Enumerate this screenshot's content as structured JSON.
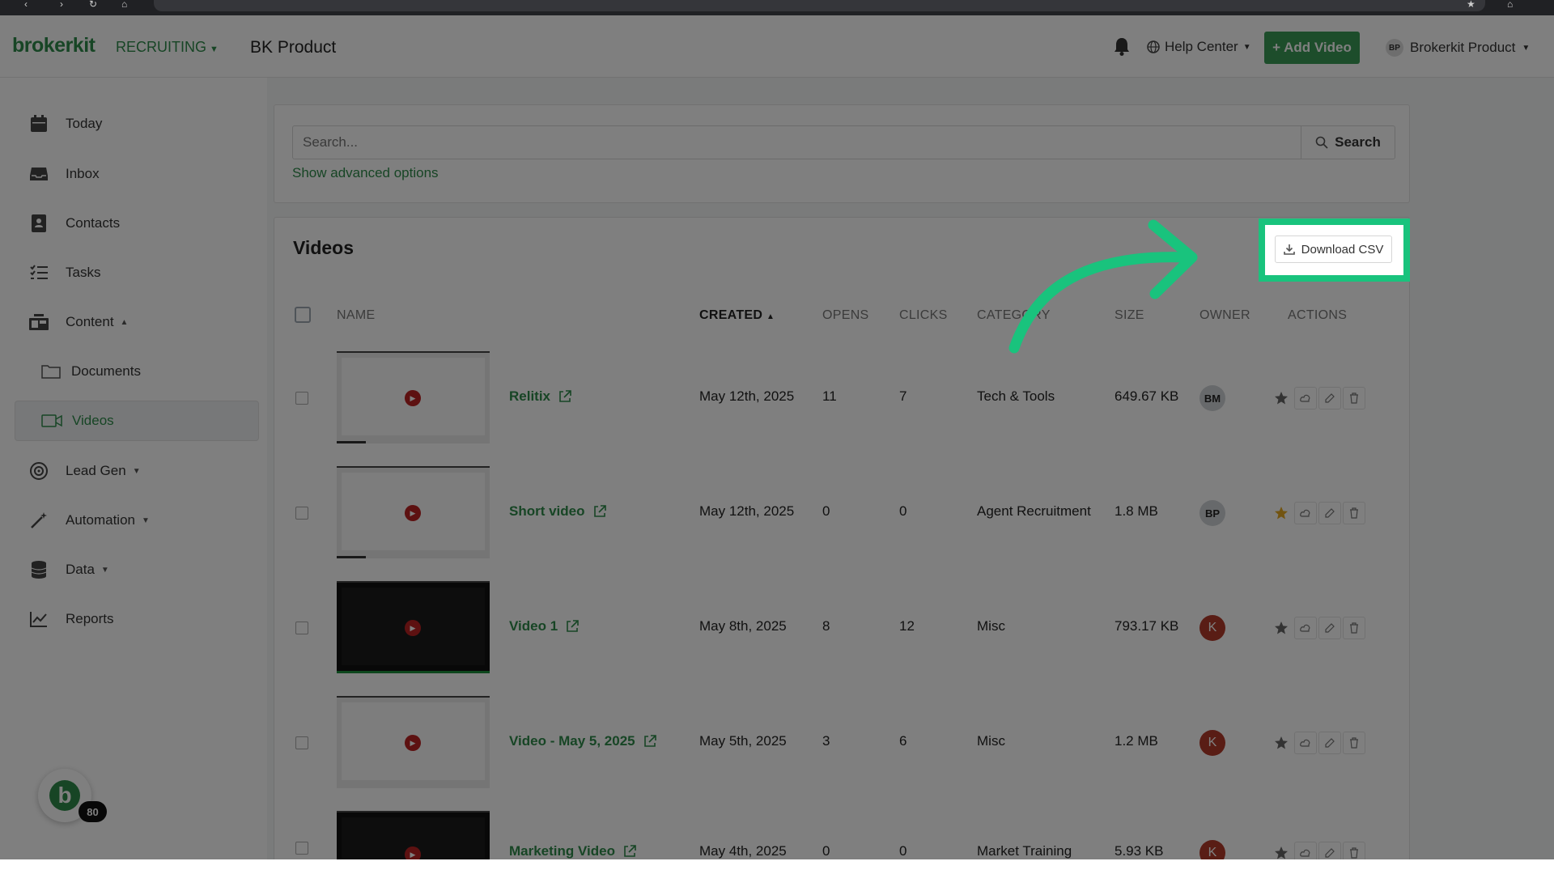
{
  "header": {
    "brand": "brokerkit",
    "department": "RECRUITING",
    "product": "BK Product",
    "help_label": "Help Center",
    "add_video_label": "+ Add Video",
    "account_initials": "BP",
    "account_name": "Brokerkit Product"
  },
  "sidebar": {
    "items": [
      {
        "label": "Today",
        "icon": "calendar-icon"
      },
      {
        "label": "Inbox",
        "icon": "inbox-icon"
      },
      {
        "label": "Contacts",
        "icon": "contacts-icon"
      },
      {
        "label": "Tasks",
        "icon": "tasks-icon"
      },
      {
        "label": "Content",
        "icon": "content-icon"
      },
      {
        "label": "Documents",
        "icon": "folder-icon"
      },
      {
        "label": "Videos",
        "icon": "video-icon"
      },
      {
        "label": "Lead Gen",
        "icon": "lead-gen-icon"
      },
      {
        "label": "Automation",
        "icon": "magic-wand-icon"
      },
      {
        "label": "Data",
        "icon": "database-icon"
      },
      {
        "label": "Reports",
        "icon": "chart-icon"
      }
    ],
    "badge_letter": "b",
    "badge_count": "80"
  },
  "search": {
    "placeholder": "Search...",
    "button_label": "Search",
    "advanced_label": "Show advanced options"
  },
  "videos": {
    "title": "Videos",
    "download_label": "Download CSV",
    "columns": {
      "name": "NAME",
      "created": "CREATED",
      "opens": "OPENS",
      "clicks": "CLICKS",
      "category": "CATEGORY",
      "size": "SIZE",
      "owner": "OWNER",
      "actions": "ACTIONS"
    },
    "rows": [
      {
        "name": "Relitix",
        "created": "May 12th, 2025",
        "opens": "11",
        "clicks": "7",
        "category": "Tech & Tools",
        "size": "649.67 KB",
        "owner": "BM",
        "starred": false
      },
      {
        "name": "Short video",
        "created": "May 12th, 2025",
        "opens": "0",
        "clicks": "0",
        "category": "Agent Recruitment",
        "size": "1.8 MB",
        "owner": "BP",
        "starred": true
      },
      {
        "name": "Video 1",
        "created": "May 8th, 2025",
        "opens": "8",
        "clicks": "12",
        "category": "Misc",
        "size": "793.17 KB",
        "owner": "K",
        "starred": false
      },
      {
        "name": "Video - May 5, 2025",
        "created": "May 5th, 2025",
        "opens": "3",
        "clicks": "6",
        "category": "Misc",
        "size": "1.2 MB",
        "owner": "K",
        "starred": false
      },
      {
        "name": "Marketing Video",
        "created": "May 4th, 2025",
        "opens": "0",
        "clicks": "0",
        "category": "Market Training",
        "size": "5.93 KB",
        "owner": "K",
        "starred": false
      }
    ]
  },
  "colors": {
    "brand_green": "#2e8b4a",
    "highlight": "#19c37d",
    "owner_red": "#b33a2a",
    "star_gold": "#e5a823"
  }
}
